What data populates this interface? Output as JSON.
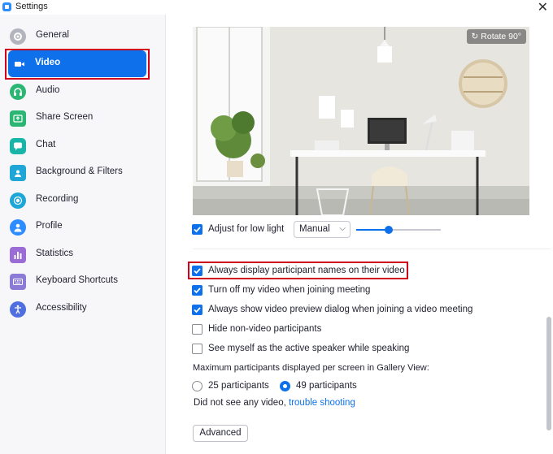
{
  "window": {
    "title": "Settings",
    "close_glyph": "✕"
  },
  "sidebar": {
    "items": [
      {
        "label": "General",
        "icon": "gear-icon",
        "color": "#b4b4be"
      },
      {
        "label": "Video",
        "icon": "video-camera-icon",
        "color": "#ffffff"
      },
      {
        "label": "Audio",
        "icon": "headphones-icon",
        "color": "#2bb673"
      },
      {
        "label": "Share Screen",
        "icon": "share-screen-icon",
        "color": "#2bb673"
      },
      {
        "label": "Chat",
        "icon": "chat-bubble-icon",
        "color": "#18b5a8"
      },
      {
        "label": "Background & Filters",
        "icon": "person-background-icon",
        "color": "#1ea7d6"
      },
      {
        "label": "Recording",
        "icon": "record-icon",
        "color": "#1ea7d6"
      },
      {
        "label": "Profile",
        "icon": "profile-icon",
        "color": "#2d8cff"
      },
      {
        "label": "Statistics",
        "icon": "bar-chart-icon",
        "color": "#9b6bd6"
      },
      {
        "label": "Keyboard Shortcuts",
        "icon": "keyboard-icon",
        "color": "#8b7ad6"
      },
      {
        "label": "Accessibility",
        "icon": "accessibility-icon",
        "color": "#4f6fe0"
      }
    ],
    "active_index": 1
  },
  "preview": {
    "rotate_label": "Rotate 90°"
  },
  "low_light": {
    "label": "Adjust for low light",
    "checked": true,
    "mode": "Manual",
    "level": 0.38
  },
  "options": [
    {
      "label": "Always display participant names on their video",
      "checked": true
    },
    {
      "label": "Turn off my video when joining meeting",
      "checked": true
    },
    {
      "label": "Always show video preview dialog when joining a video meeting",
      "checked": true
    },
    {
      "label": "Hide non-video participants",
      "checked": false
    },
    {
      "label": "See myself as the active speaker while speaking",
      "checked": false
    }
  ],
  "gallery": {
    "label": "Maximum participants displayed per screen in Gallery View:",
    "options": [
      {
        "label": "25 participants",
        "selected": false
      },
      {
        "label": "49 participants",
        "selected": true
      }
    ]
  },
  "trouble": {
    "text": "Did not see any video,",
    "link": "trouble shooting"
  },
  "advanced_label": "Advanced",
  "colors": {
    "accent": "#0e71eb",
    "highlight": "#d0021b"
  }
}
